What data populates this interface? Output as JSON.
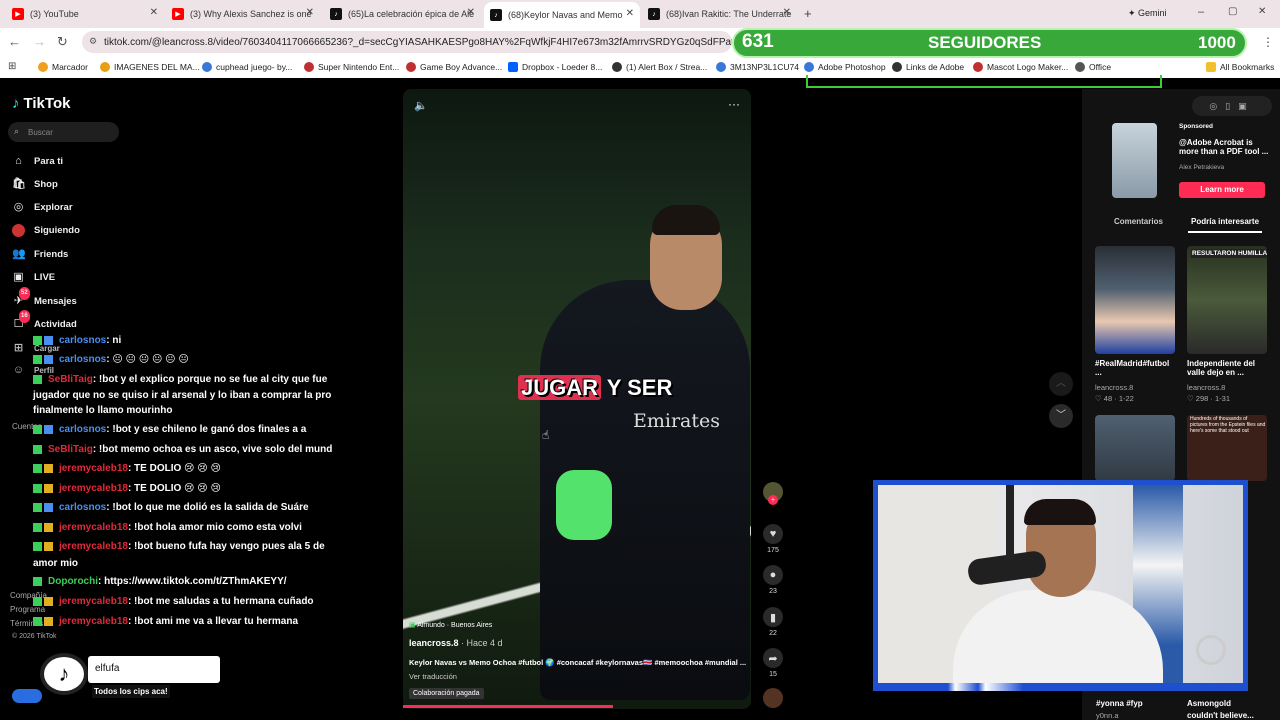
{
  "tabs": [
    {
      "label": "(3) YouTube",
      "color": "#ff0000"
    },
    {
      "label": "(3) Why Alexis Sanchez is one o",
      "color": "#ff0000"
    },
    {
      "label": "(65)La celebración épica de Ale",
      "color": "#111111"
    },
    {
      "label": "(68)Keylor Navas and Memo",
      "color": "#111111"
    },
    {
      "label": "(68)Ivan Rakitic: The Underrate",
      "color": "#111111"
    }
  ],
  "gemini": "Gemini",
  "url": "tiktok.com/@leancross.8/video/7603404117066665236?_d=secCgYIASAHKAESPgo8HAY%2FqWfkjF4HI7e673m32fAmrrvSRDYGz0qSdFPafZ5OZVtpWjQZ5",
  "bookmarks": [
    "Marcador",
    "IMAGENES DEL MA...",
    "cuphead juego- by...",
    "Super Nintendo Ent...",
    "Game Boy Advance...",
    "Dropbox - Loeder 8...",
    "(1) Alert Box / Strea...",
    "3M13NP3L1CU74",
    "Adobe Photoshop",
    "Links de Adobe",
    "Mascot Logo Maker...",
    "Office",
    "All Bookmarks"
  ],
  "followers": {
    "count": "631",
    "label": "SEGUIDORES",
    "goal": "1000"
  },
  "tiktok": {
    "logo": "TikTok",
    "search_placeholder": "Buscar",
    "nav": [
      "Para ti",
      "Shop",
      "Explorar",
      "Siguiendo",
      "Friends",
      "LIVE",
      "Mensajes",
      "Actividad",
      "Cargar",
      "Perfil"
    ],
    "msg_badge": "52",
    "act_badge": "16",
    "faint": [
      "Cuentas",
      "Compañía",
      "Programa",
      "Términos",
      "© 2026 TikTok"
    ]
  },
  "chat": [
    {
      "user": "carlosnos",
      "text": ": ni",
      "color": "#4a8ff0"
    },
    {
      "user": "carlosnos",
      "text": ": 😐 😐 😐 😐 😐 😐",
      "color": "#4a8ff0"
    },
    {
      "user": "SeBliTaig",
      "text": ": !bot y el explico porque no se fue al city que fue",
      "color": "#e02a3a"
    },
    {
      "user": "",
      "text": "jugador que no se quiso ir al arsenal y lo iban a comprar la pro",
      "color": "#fff"
    },
    {
      "user": "",
      "text": "finalmente lo llamo mourinho",
      "color": "#fff"
    },
    {
      "user": "carlosnos",
      "text": ": !bot y ese chileno le ganó dos finales a a",
      "color": "#4a8ff0"
    },
    {
      "user": "SeBliTaig",
      "text": ": !bot memo ochoa es un asco, vive solo del mund",
      "color": "#e02a3a"
    },
    {
      "user": "jeremycaleb18",
      "text": ": TE DOLIO 😢 😢 😢",
      "color": "#e02a3a"
    },
    {
      "user": "jeremycaleb18",
      "text": ": TE DOLIO 😢 😢 😢",
      "color": "#e02a3a"
    },
    {
      "user": "carlosnos",
      "text": ": !bot lo que me dolió es la salida de Suáre",
      "color": "#4a8ff0"
    },
    {
      "user": "jeremycaleb18",
      "text": ": !bot hola amor mio como esta volvi",
      "color": "#e02a3a"
    },
    {
      "user": "jeremycaleb18",
      "text": ": !bot bueno fufa hay vengo pues ala 5 de",
      "color": "#e02a3a"
    },
    {
      "user": "",
      "text": "amor mio",
      "color": "#fff"
    },
    {
      "user": "Doporochi",
      "text": ": https://www.tiktok.com/t/ZThmAKEYY/",
      "color": "#3ccf5a"
    },
    {
      "user": "jeremycaleb18",
      "text": ": !bot me saludas a tu hermana cuñado",
      "color": "#e02a3a"
    },
    {
      "user": "jeremycaleb18",
      "text": ": !bot ami me va a llevar tu hermana",
      "color": "#e02a3a"
    }
  ],
  "video": {
    "caption_a": "JUGAR",
    "caption_b": "Y SER",
    "location": "Almundo · Buenos Aires",
    "author": "leancross.8",
    "time": "· Hace 4 d",
    "desc": "Keylor Navas vs Memo Ochoa #futbol 🌍 #concacaf #keylornavas🇨🇷 #memoochoa #mundial ...",
    "translate": "Ver traducción",
    "paid": "Colaboración pagada",
    "likes": "175",
    "comments": "23",
    "saves": "22",
    "shares": "15"
  },
  "right": {
    "sponsored": "Sponsored",
    "ad_title": "@Adobe Acrobat is more than a PDF tool ...",
    "ad_author": "Alex Petrakieva",
    "learn": "Learn more",
    "tab_comments": "Comentarios",
    "tab_interest": "Podría interesarte",
    "cards": [
      {
        "title": "#RealMadrid#futbol ...",
        "author": "leancross.8",
        "stats": "♡ 48 · 1-22"
      },
      {
        "title": "Independiente del valle dejo en ...",
        "author": "leancross.8",
        "stats": "♡ 298 · 1-31"
      }
    ],
    "bottom1": "#yonna #fyp",
    "bottom1b": "y0nn.a",
    "bottom2": "Asmongold",
    "bottom2b": "couldn't believe...",
    "thumb2_top": "RESULTARON HUMILLADOS",
    "thumb4_text": "Hundreds of thousands of pictures from the Epstein files and here's some that stood out"
  },
  "chatbox": {
    "value": "elfufa",
    "clip": "Todos los cips aca!"
  }
}
